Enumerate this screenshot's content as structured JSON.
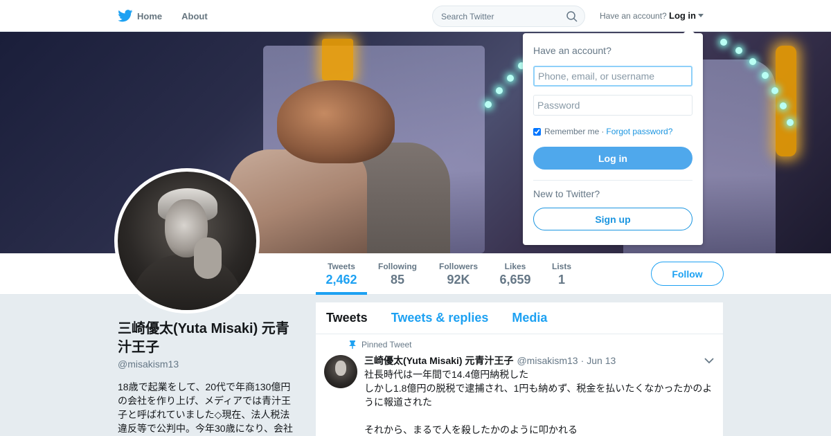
{
  "nav": {
    "home_label": "Home",
    "about_label": "About",
    "search_placeholder": "Search Twitter",
    "have_account": "Have an account?",
    "login_label": "Log in",
    "brand_color": "#1da1f2"
  },
  "profile": {
    "name": "三崎優太(Yuta Misaki) 元青汁王子",
    "handle": "@misakism13",
    "bio": "18歳で起業をして、20代で年商130億円の会社を作り上げ、メディアでは青汁王子と呼ばれていました◇現在、法人税法違反等で公判中。今年30歳になり、会社"
  },
  "stats": [
    {
      "label": "Tweets",
      "value": "2,462"
    },
    {
      "label": "Following",
      "value": "85"
    },
    {
      "label": "Followers",
      "value": "92K"
    },
    {
      "label": "Likes",
      "value": "6,659"
    },
    {
      "label": "Lists",
      "value": "1"
    }
  ],
  "follow_label": "Follow",
  "timeline": {
    "tabs": [
      "Tweets",
      "Tweets & replies",
      "Media"
    ],
    "pinned_label": "Pinned Tweet",
    "tweet": {
      "name": "三崎優太(Yuta Misaki) 元青汁王子",
      "handle": "@misakism13",
      "separator": "·",
      "date": "Jun 13",
      "lines": [
        "社長時代は一年間で14.4億円納税した",
        "しかし1.8億円の脱税で逮捕され、1円も納めず、税金を払いたくなかったかのように報道された",
        "",
        "それから、まるで人を殺したかのように叩かれる"
      ]
    }
  },
  "login_dropdown": {
    "title": "Have an account?",
    "username_placeholder": "Phone, email, or username",
    "password_placeholder": "Password",
    "remember_label": "Remember me",
    "separator": "·",
    "forgot_label": "Forgot password?",
    "login_button": "Log in",
    "new_label": "New to Twitter?",
    "signup_button": "Sign up"
  }
}
